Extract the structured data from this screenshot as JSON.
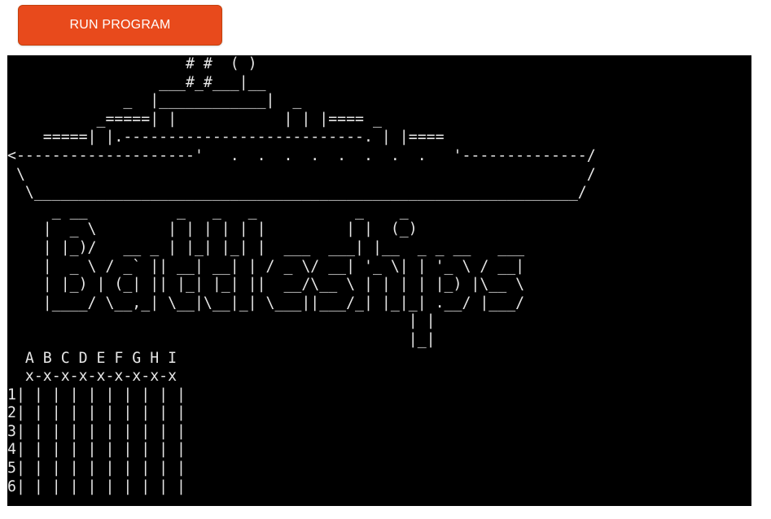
{
  "toolbar": {
    "run_label": "RUN PROGRAM"
  },
  "terminal": {
    "output": "                    # #  ( )\n                 ___#_#___|__\n             _  |____________|  _\n          _=====| |            | | |==== _\n    =====| |.---------------------------. | |====\n<--------------------'   .  .  .  .  .  .  .  .   '--------------/\n \\                                                               /\n  \\_____________________________________________________________/\n     _ __          _   _   _           _    _\n    |  _ \\        | | | | | |         | |  (_)\n    | |_)/   __ _ | |_| |_| |  ___  ___| |__  _ _ __   ___\n    |  _ \\ / _` || __| __| | / _ \\/ __| '_ \\| | '_ \\ / __|\n    | |_) | (_| || |_| |_| ||  __/\\__ \\ | | | | |_) |\\__ \\\n    |____/ \\__,_| \\__|\\__|_| \\___||___/_| |_|_| .__/ |___/\n                                             | |\n                                             |_|\n  A B C D E F G H I\n  x-x-x-x-x-x-x-x-x\n1| | | | | | | | | |\n2| | | | | | | | | |\n3| | | | | | | | | |\n4| | | | | | | | | |\n5| | | | | | | | | |\n6| | | | | | | | | |"
  }
}
